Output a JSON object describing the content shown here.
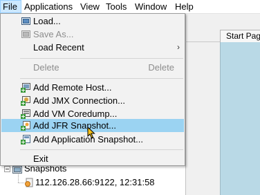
{
  "menubar": {
    "items": [
      {
        "label": "File"
      },
      {
        "label": "Applications"
      },
      {
        "label": "View"
      },
      {
        "label": "Tools"
      },
      {
        "label": "Window"
      },
      {
        "label": "Help"
      }
    ]
  },
  "tab": {
    "label": "Start Pag"
  },
  "file_menu": {
    "items": [
      {
        "label": "Load...",
        "icon": "load-icon"
      },
      {
        "label": "Save As...",
        "icon": "save-icon"
      },
      {
        "label": "Load Recent",
        "arrow": "›"
      },
      {
        "label": "Delete",
        "shortcut": "Delete"
      },
      {
        "label": "Add Remote Host...",
        "icon": "add-remote-host-icon"
      },
      {
        "label": "Add JMX Connection...",
        "icon": "add-jmx-icon"
      },
      {
        "label": "Add VM Coredump...",
        "icon": "add-coredump-icon"
      },
      {
        "label": "Add JFR Snapshot...",
        "icon": "add-jfr-icon"
      },
      {
        "label": "Add Application Snapshot...",
        "icon": "add-app-snapshot-icon"
      },
      {
        "label": "Exit"
      }
    ]
  },
  "tree": {
    "snapshots_label": "Snapshots",
    "snapshot_item": "112.126.28.66:9122, 12:31:58"
  },
  "colors": {
    "menu_bg": "#f2f2f2",
    "highlight": "#9bd3f2",
    "menubar_open": "#cce8ff",
    "content_blue": "#b9d9e6"
  }
}
